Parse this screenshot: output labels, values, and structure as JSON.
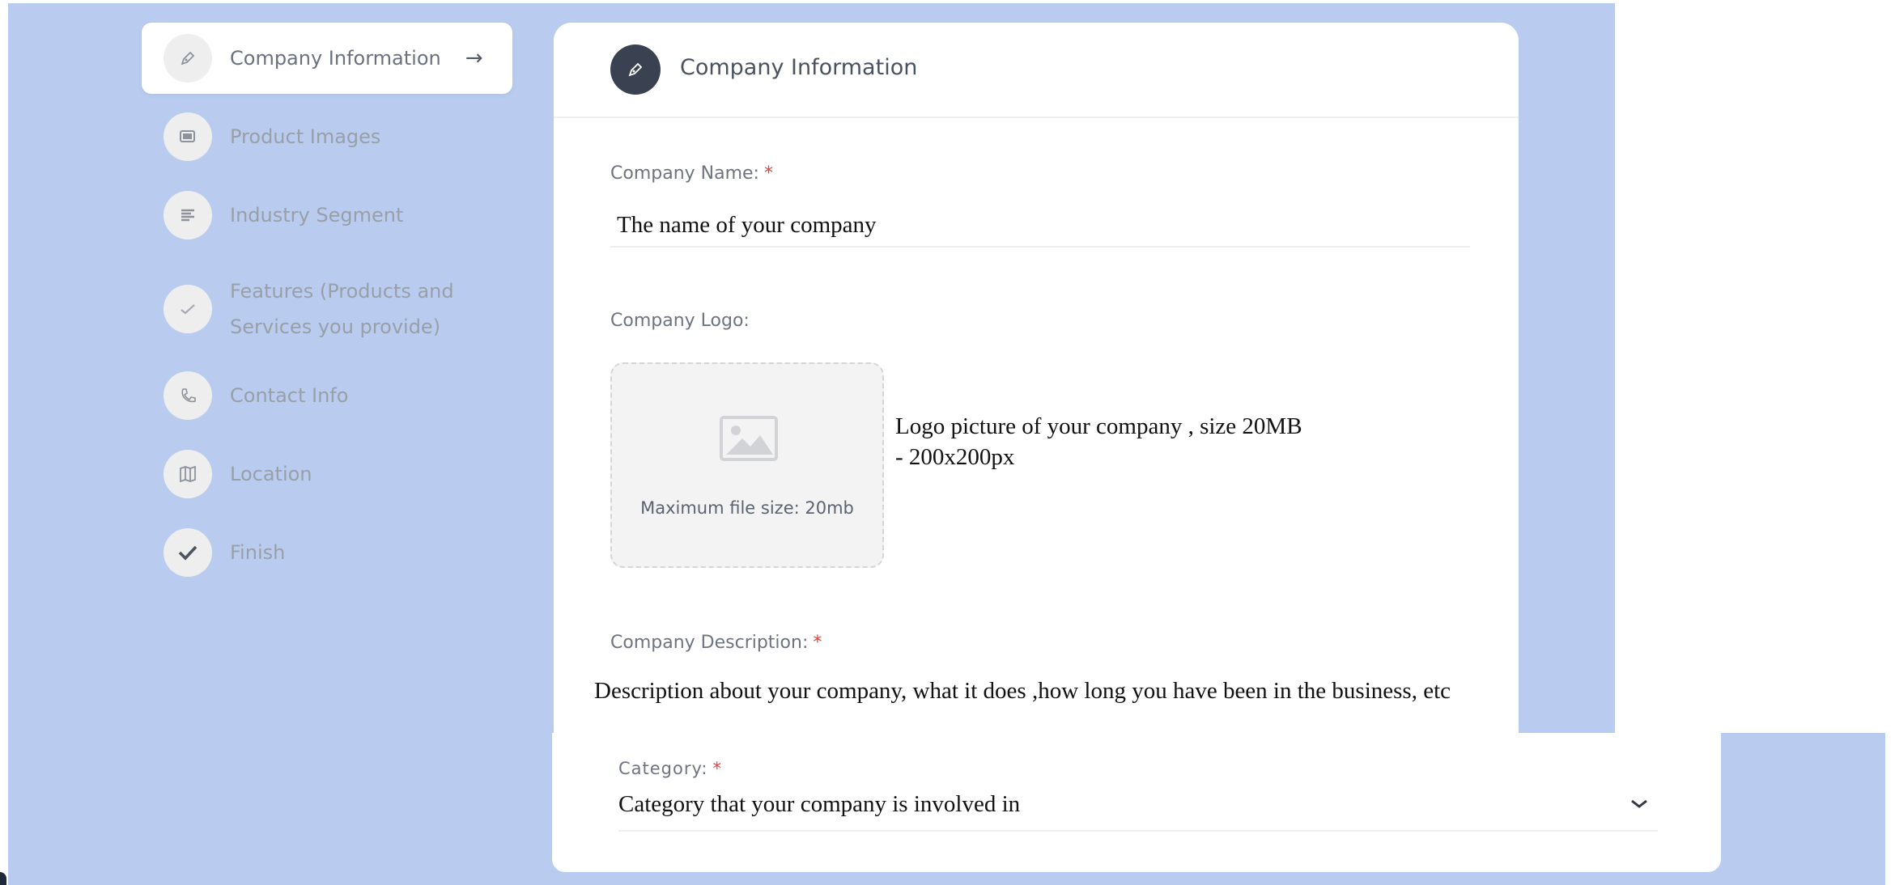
{
  "colors": {
    "background": "#b9ccef",
    "card": "#ffffff",
    "header_icon_bg": "#3a4150",
    "required_marker": "#e2403f"
  },
  "sidebar": {
    "steps": [
      {
        "label": "Company Information",
        "icon": "pen-icon",
        "active": true,
        "arrow": "→"
      },
      {
        "label": "Product Images",
        "icon": "images-icon"
      },
      {
        "label": "Industry Segment",
        "icon": "list-icon"
      },
      {
        "label": "Features (Products and",
        "label_line2": "Services you provide)",
        "icon": "check-icon"
      },
      {
        "label": "Contact Info",
        "icon": "phone-icon"
      },
      {
        "label": "Location",
        "icon": "map-icon"
      },
      {
        "label": "Finish",
        "icon": "checkmark-icon"
      }
    ]
  },
  "form": {
    "header_title": "Company Information",
    "header_icon": "pen-icon",
    "required_marker": "*",
    "company_name": {
      "label": "Company Name:",
      "value": "The name of your company"
    },
    "company_logo": {
      "label": "Company Logo:",
      "upload_caption": "Maximum file size: 20mb",
      "upload_icon": "image-icon",
      "hint_line1": "Logo picture of your company , size 20MB",
      "hint_line2": "- 200x200px"
    },
    "company_description": {
      "label": "Company Description:",
      "value": "Description about your company, what it does ,how long you have been in the business, etc"
    },
    "category": {
      "label": "Category:",
      "value": "Category that your company is involved in",
      "chevron": "⌄"
    }
  }
}
